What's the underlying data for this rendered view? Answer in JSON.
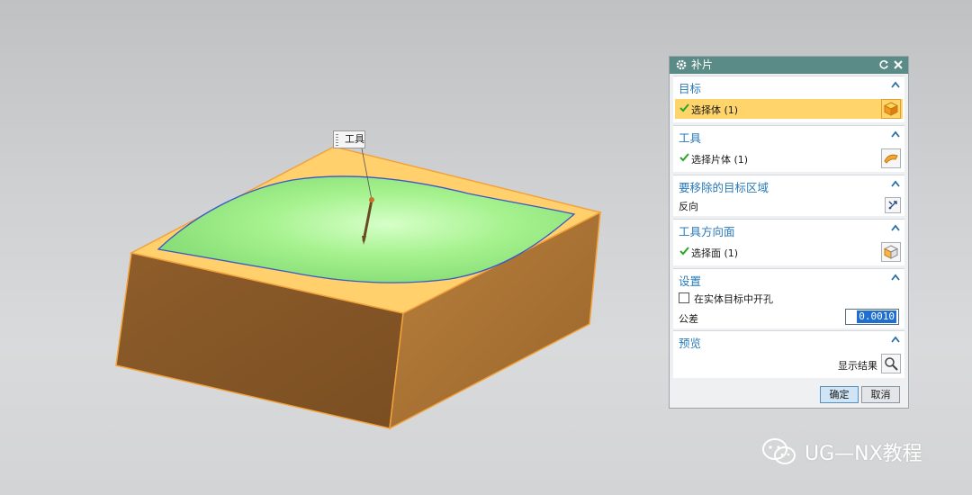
{
  "callout": {
    "label": "工具"
  },
  "watermark": {
    "text": "UG—NX教程"
  },
  "dialog": {
    "title": "补片",
    "sections": {
      "target": {
        "header": "目标",
        "row_label": "选择体 (1)"
      },
      "tool": {
        "header": "工具",
        "row_label": "选择片体 (1)"
      },
      "remove_region": {
        "header": "要移除的目标区域",
        "row_label": "反向"
      },
      "tool_face": {
        "header": "工具方向面",
        "row_label": "选择面 (1)"
      },
      "settings": {
        "header": "设置",
        "checkbox_label": "在实体目标中开孔",
        "checkbox_checked": false,
        "tolerance_label": "公差",
        "tolerance_value": "0.0010"
      },
      "preview": {
        "header": "预览",
        "show_result_label": "显示结果"
      }
    },
    "buttons": {
      "ok": "确定",
      "cancel": "取消"
    }
  },
  "colors": {
    "titlebar": "#5b8b87",
    "section_header": "#2a7ab8",
    "selected_row": "#ffd56b",
    "check": "#2aa52a",
    "block_top": "#ffcf6a",
    "block_side_left": "#8a5a2a",
    "block_side_right": "#ad7434",
    "sheet": "#9ff08a"
  },
  "icons": {
    "gear": "gear-icon",
    "reset": "reset-icon",
    "close": "close-icon",
    "chevron": "chevron-up-icon",
    "body": "solid-body-icon",
    "sheet": "sheet-body-icon",
    "reverse": "reverse-direction-icon",
    "face": "face-icon",
    "magnifier": "magnifier-icon"
  }
}
